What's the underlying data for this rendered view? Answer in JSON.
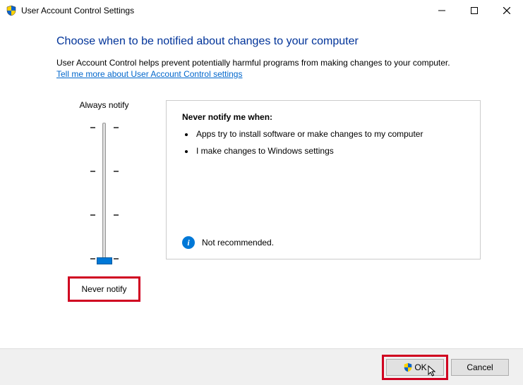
{
  "window": {
    "title": "User Account Control Settings"
  },
  "main": {
    "heading": "Choose when to be notified about changes to your computer",
    "description": "User Account Control helps prevent potentially harmful programs from making changes to your computer.",
    "help_link": "Tell me more about User Account Control settings"
  },
  "slider": {
    "top_label": "Always notify",
    "bottom_label": "Never notify",
    "position": 3,
    "levels": 4
  },
  "panel": {
    "heading": "Never notify me when:",
    "bullets": [
      "Apps try to install software or make changes to my computer",
      "I make changes to Windows settings"
    ],
    "footer": "Not recommended."
  },
  "buttons": {
    "ok": "OK",
    "cancel": "Cancel"
  }
}
